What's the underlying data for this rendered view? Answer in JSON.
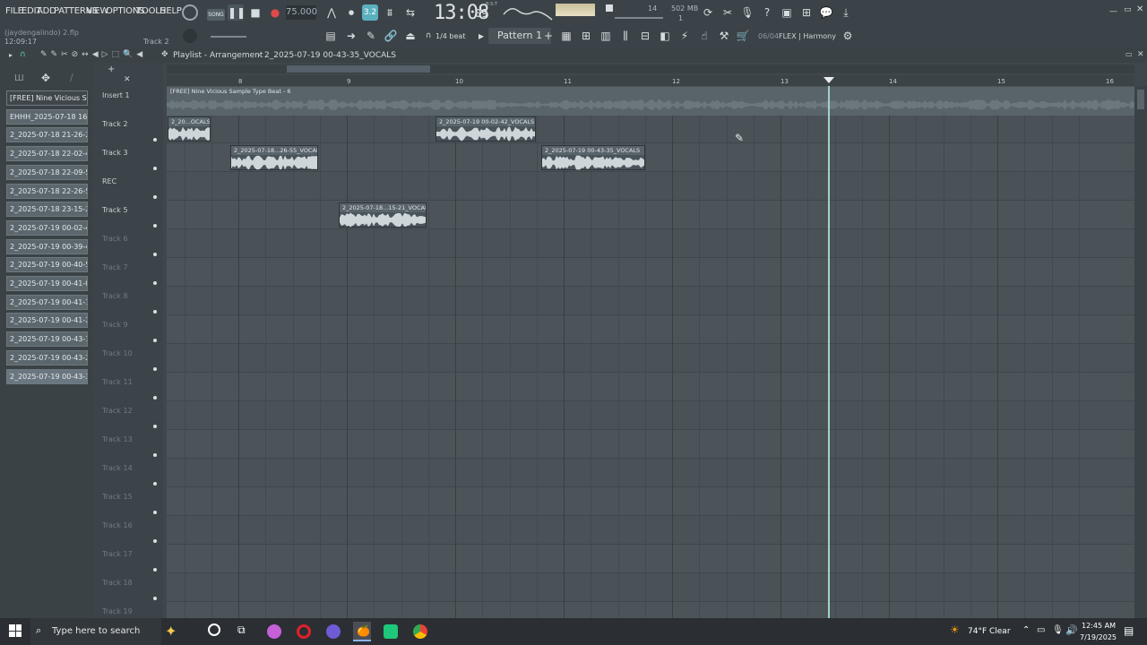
{
  "menu": [
    "FILE",
    "EDIT",
    "ADD",
    "PATTERNS",
    "VIEW",
    "OPTIONS",
    "TOOLS",
    "HELP"
  ],
  "project": {
    "user_file": "(jaydengalindo) 2.flp",
    "time": "12:09:17",
    "track": "Track 2"
  },
  "transport": {
    "song_label": "SONG",
    "tempo": "75.000",
    "clock": "13:08",
    "clock_sub": "09",
    "bst": "B:S:T",
    "cpu": "14",
    "mem": "502 MB",
    "mem2": "1"
  },
  "toolbar2": {
    "snap": "1/4 beat",
    "pattern": "Pattern 1",
    "hint": "06/04",
    "plugin": "FLEX | Harmony"
  },
  "playlist": {
    "title": "Playlist - Arrangement",
    "breadcrumb": "2_2025-07-19 00-43-35_VOCALS"
  },
  "browser": {
    "items": [
      "[FREE] Nine Vicious Samp...",
      "EHHH_2025-07-18 16-18...",
      "2_2025-07-18 21-26-29...",
      "2_2025-07-18 22-02-44...",
      "2_2025-07-18 22-09-52...",
      "2_2025-07-18 22-26-55...",
      "2_2025-07-18 23-15-21...",
      "2_2025-07-19 00-02-42...",
      "2_2025-07-19 00-39-41...",
      "2_2025-07-19 00-40-52...",
      "2_2025-07-19 00-41-03...",
      "2_2025-07-19 00-41-14...",
      "2_2025-07-19 00-41-25...",
      "2_2025-07-19 00-43-10...",
      "2_2025-07-19 00-43-23...",
      "2_2025-07-19 00-43-35..."
    ]
  },
  "tracks": [
    "Insert 1",
    "Track 2",
    "Track 3",
    "REC",
    "Track 5",
    "Track 6",
    "Track 7",
    "Track 8",
    "Track 9",
    "Track 10",
    "Track 11",
    "Track 12",
    "Track 13",
    "Track 14",
    "Track 15",
    "Track 16",
    "Track 17",
    "Track 18",
    "Track 19"
  ],
  "ruler": [
    "8",
    "9",
    "10",
    "11",
    "12",
    "13",
    "14",
    "15",
    "16"
  ],
  "clips": {
    "beat": "[FREE] Nine Vicious Sample Type Beat - 6",
    "c1": "2_20...OCALS",
    "c2": "2_2025-07-19 00-02-42_VOCALS",
    "c3": "2_2025-07-18...26-55_VOCALS",
    "c4": "2_2025-07-19 00-43-35_VOCALS",
    "c5": "2_2025-07-18...15-21_VOCALS"
  },
  "taskbar": {
    "search": "Type here to search",
    "weather": "74°F  Clear",
    "time": "12:45 AM",
    "date": "7/19/2025"
  }
}
